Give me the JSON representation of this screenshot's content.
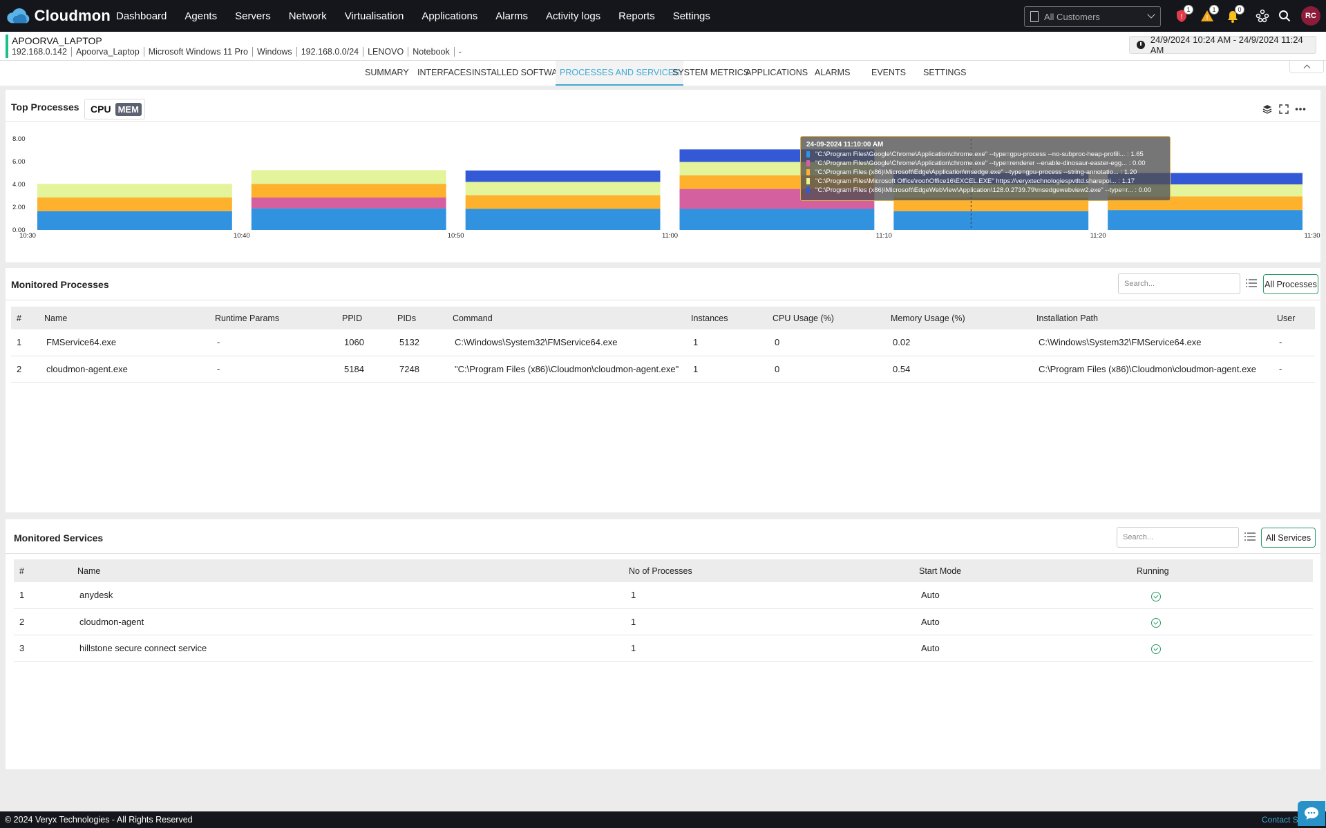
{
  "app": {
    "name": "Cloudmon"
  },
  "nav": [
    "Dashboard",
    "Agents",
    "Servers",
    "Network",
    "Virtualisation",
    "Applications",
    "Alarms",
    "Activity logs",
    "Reports",
    "Settings"
  ],
  "customer_select": {
    "value": "All Customers"
  },
  "badges": {
    "alerts": "1",
    "warnings": "1",
    "notifications": "0"
  },
  "user": {
    "initials": "RC"
  },
  "device": {
    "name": "APOORVA_LAPTOP",
    "meta": [
      "192.168.0.142",
      "Apoorva_Laptop",
      "Microsoft Windows 11 Pro",
      "Windows",
      "192.168.0.0/24",
      "LENOVO",
      "Notebook",
      "-"
    ]
  },
  "date_range": "24/9/2024 10:24 AM - 24/9/2024 11:24 AM",
  "tabs": [
    "SUMMARY",
    "INTERFACES",
    "INSTALLED SOFTWARE",
    "PROCESSES AND SERVICES",
    "SYSTEM METRICS",
    "APPLICATIONS",
    "ALARMS",
    "EVENTS",
    "SETTINGS"
  ],
  "active_tab": "PROCESSES AND SERVICES",
  "top_processes": {
    "title": "Top Processes",
    "toggle": {
      "cpu": "CPU",
      "mem": "MEM",
      "selected": "MEM"
    }
  },
  "chart_data": {
    "type": "bar",
    "stacked": true,
    "x_ticks": [
      "10:30",
      "10:40",
      "10:50",
      "11:00",
      "11:10",
      "11:20",
      "11:30"
    ],
    "y_ticks": [
      "0.00",
      "2.00",
      "4.00",
      "6.00",
      "8.00"
    ],
    "ylim": [
      0,
      8
    ],
    "categories": [
      "10:30",
      "10:40",
      "10:50",
      "11:00",
      "11:10",
      "11:20"
    ],
    "series": [
      {
        "color": "#3192e0",
        "values": [
          1.65,
          1.9,
          1.85,
          1.85,
          1.65,
          1.75
        ]
      },
      {
        "color": "#d4609f",
        "values": [
          0,
          0.95,
          0,
          1.75,
          0,
          0
        ]
      },
      {
        "color": "#fdb12d",
        "values": [
          1.2,
          1.2,
          1.2,
          1.2,
          1.2,
          1.2
        ]
      },
      {
        "color": "#e4f49a",
        "values": [
          1.2,
          1.2,
          1.17,
          1.17,
          1.17,
          1.05
        ]
      },
      {
        "color": "#3359d6",
        "values": [
          0,
          0,
          1.0,
          1.1,
          1.0,
          1.0
        ]
      }
    ],
    "tooltip": {
      "title": "24-09-2024 11:10:00 AM",
      "rows": [
        {
          "color": "#3192e0",
          "label": "\"C:\\Program Files\\Google\\Chrome\\Application\\chrome.exe\" --type=gpu-process --no-subproc-heap-profili... : 1.65"
        },
        {
          "color": "#d4609f",
          "label": "\"C:\\Program Files\\Google\\Chrome\\Application\\chrome.exe\" --type=renderer --enable-dinosaur-easter-egg... : 0.00"
        },
        {
          "color": "#fdb12d",
          "label": "\"C:\\Program Files (x86)\\Microsoft\\Edge\\Application\\msedge.exe\" --type=gpu-process --string-annotatio... : 1.20"
        },
        {
          "color": "#e4f49a",
          "label": "\"C:\\Program Files\\Microsoft Office\\root\\Office16\\EXCEL.EXE\" https://veryxtechnologiespvtltd.sharepoi... : 1.17"
        },
        {
          "color": "#3359d6",
          "label": "\"C:\\Program Files (x86)\\Microsoft\\EdgeWebView\\Application\\128.0.2739.79\\msedgewebview2.exe\" --type=r... : 0.00"
        }
      ]
    }
  },
  "monitored_processes": {
    "title": "Monitored Processes",
    "search_placeholder": "Search...",
    "filter_label": "All Processes",
    "columns": [
      "#",
      "Name",
      "Runtime Params",
      "PPID",
      "PIDs",
      "Command",
      "Instances",
      "CPU Usage (%)",
      "Memory Usage (%)",
      "Installation Path",
      "User"
    ],
    "rows": [
      [
        "1",
        "FMService64.exe",
        "-",
        "1060",
        "5132",
        "C:\\Windows\\System32\\FMService64.exe",
        "1",
        "0",
        "0.02",
        "C:\\Windows\\System32\\FMService64.exe",
        "-"
      ],
      [
        "2",
        "cloudmon-agent.exe",
        "-",
        "5184",
        "7248",
        "\"C:\\Program Files (x86)\\Cloudmon\\cloudmon-agent.exe\"",
        "1",
        "0",
        "0.54",
        "C:\\Program Files (x86)\\Cloudmon\\cloudmon-agent.exe",
        "-"
      ]
    ]
  },
  "monitored_services": {
    "title": "Monitored Services",
    "search_placeholder": "Search...",
    "filter_label": "All Services",
    "columns": [
      "#",
      "Name",
      "No of Processes",
      "Start Mode",
      "Running"
    ],
    "rows": [
      [
        "1",
        "anydesk",
        "1",
        "Auto"
      ],
      [
        "2",
        "cloudmon-agent",
        "1",
        "Auto"
      ],
      [
        "3",
        "hillstone secure connect service",
        "1",
        "Auto"
      ]
    ]
  },
  "footer": {
    "copyright": "© 2024 Veryx Technologies - All Rights Reserved",
    "contact": "Contact Sales"
  }
}
